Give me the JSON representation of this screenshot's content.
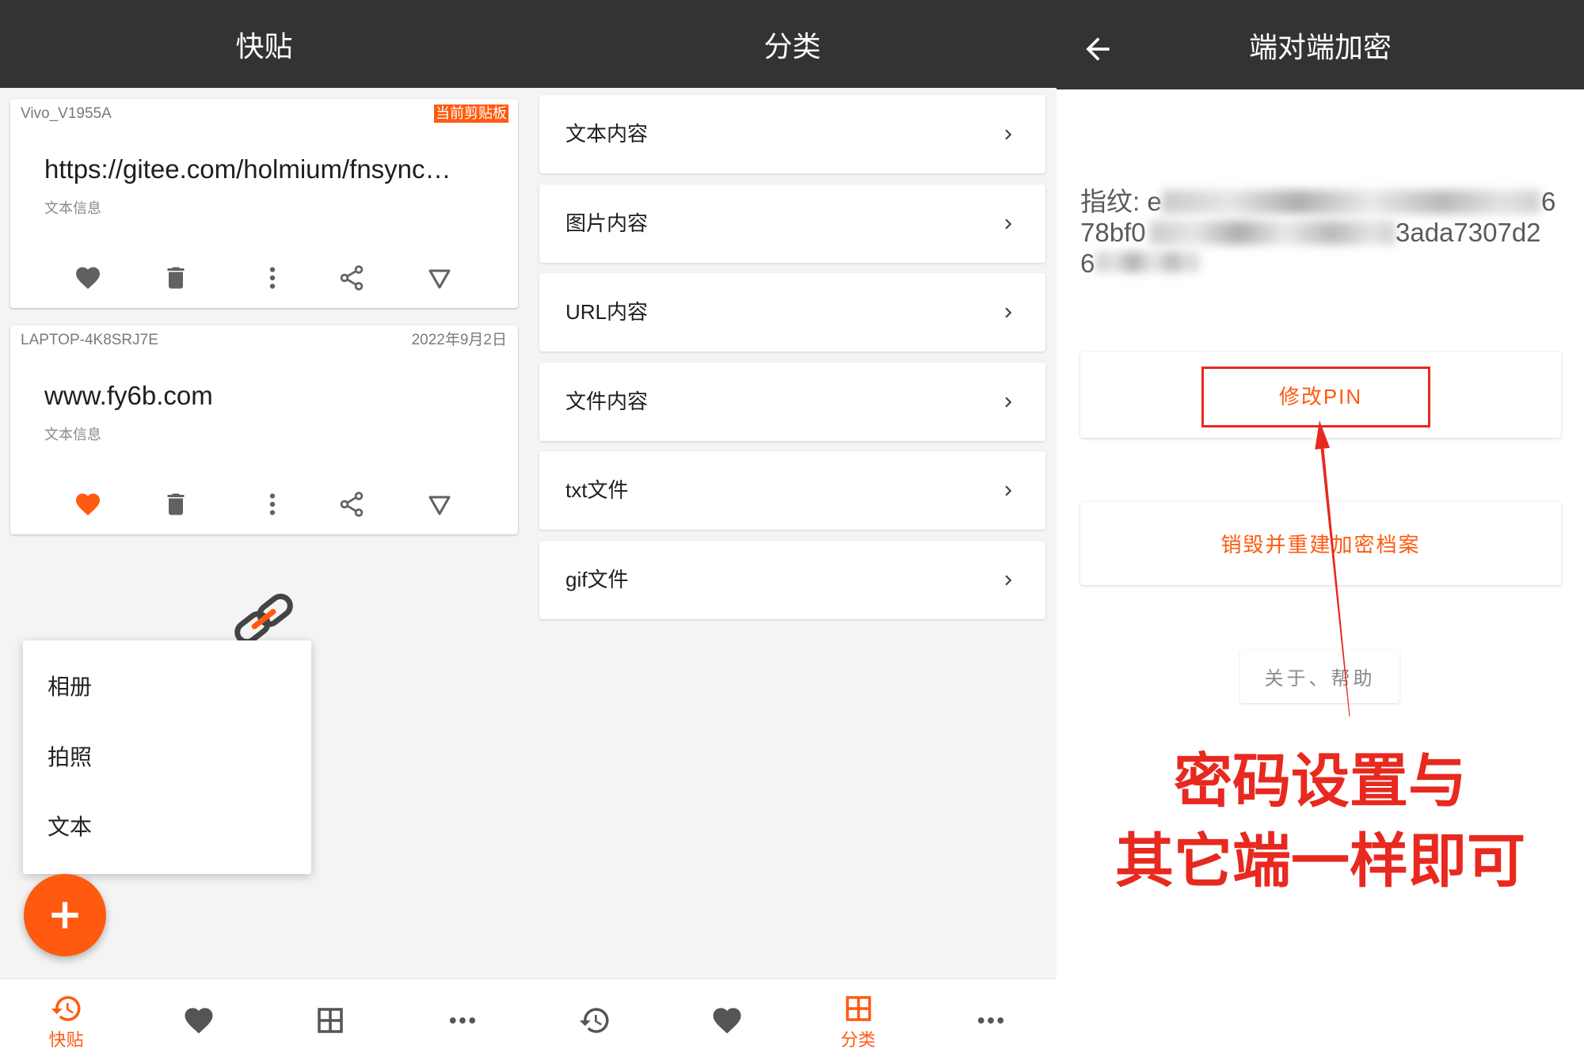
{
  "colors": {
    "header_bg": "#333333",
    "accent": "#ff5a0f",
    "annotation_red": "#e8291f",
    "page_bg": "#f4f4f4",
    "icon_gray": "#616161"
  },
  "clipboard_screen": {
    "title": "快贴",
    "cards": [
      {
        "device": "Vivo_V1955A",
        "badge": "当前剪贴板",
        "content": "https://gitee.com/holmium/fnsync…",
        "type_label": "文本信息",
        "favorited": false
      },
      {
        "device": "LAPTOP-4K8SRJ7E",
        "date": "2022年9月2日",
        "content": "www.fy6b.com",
        "type_label": "文本信息",
        "favorited": true
      }
    ],
    "card_actions": [
      "heart-icon",
      "trash-icon",
      "more-vertical-icon",
      "share-icon",
      "triangle-down-icon"
    ],
    "empty_state_icon": "link-icon",
    "add_menu": {
      "items": [
        "相册",
        "拍照",
        "文本"
      ]
    },
    "fab_icon": "plus-icon",
    "bottom_nav": [
      {
        "icon": "history-icon",
        "label": "快贴",
        "active": true
      },
      {
        "icon": "heart-icon",
        "active": false
      },
      {
        "icon": "grid-icon",
        "active": false
      },
      {
        "icon": "more-horizontal-icon",
        "active": false
      }
    ]
  },
  "category_screen": {
    "title": "分类",
    "items": [
      "文本内容",
      "图片内容",
      "URL内容",
      "文件内容",
      "txt文件",
      "gif文件"
    ],
    "item_icon": "chevron-right-icon",
    "bottom_nav": [
      {
        "icon": "history-icon",
        "active": false
      },
      {
        "icon": "heart-icon",
        "active": false
      },
      {
        "icon": "grid-icon",
        "label": "分类",
        "active": true
      },
      {
        "icon": "more-horizontal-icon",
        "active": false
      }
    ]
  },
  "encryption_screen": {
    "title": "端对端加密",
    "back_icon": "arrow-left-icon",
    "fingerprint": {
      "line1_start": "指纹: e",
      "line1_end": "6",
      "line2_start": "78bf0",
      "line2_end": "3ada7307d2",
      "line3": "6"
    },
    "change_pin_label": "修改PIN",
    "destroy_label": "销毁并重建加密档案",
    "about_label": "关于、帮助"
  },
  "annotation": {
    "lines": [
      "密码设置与",
      "其它端一样即可"
    ]
  }
}
